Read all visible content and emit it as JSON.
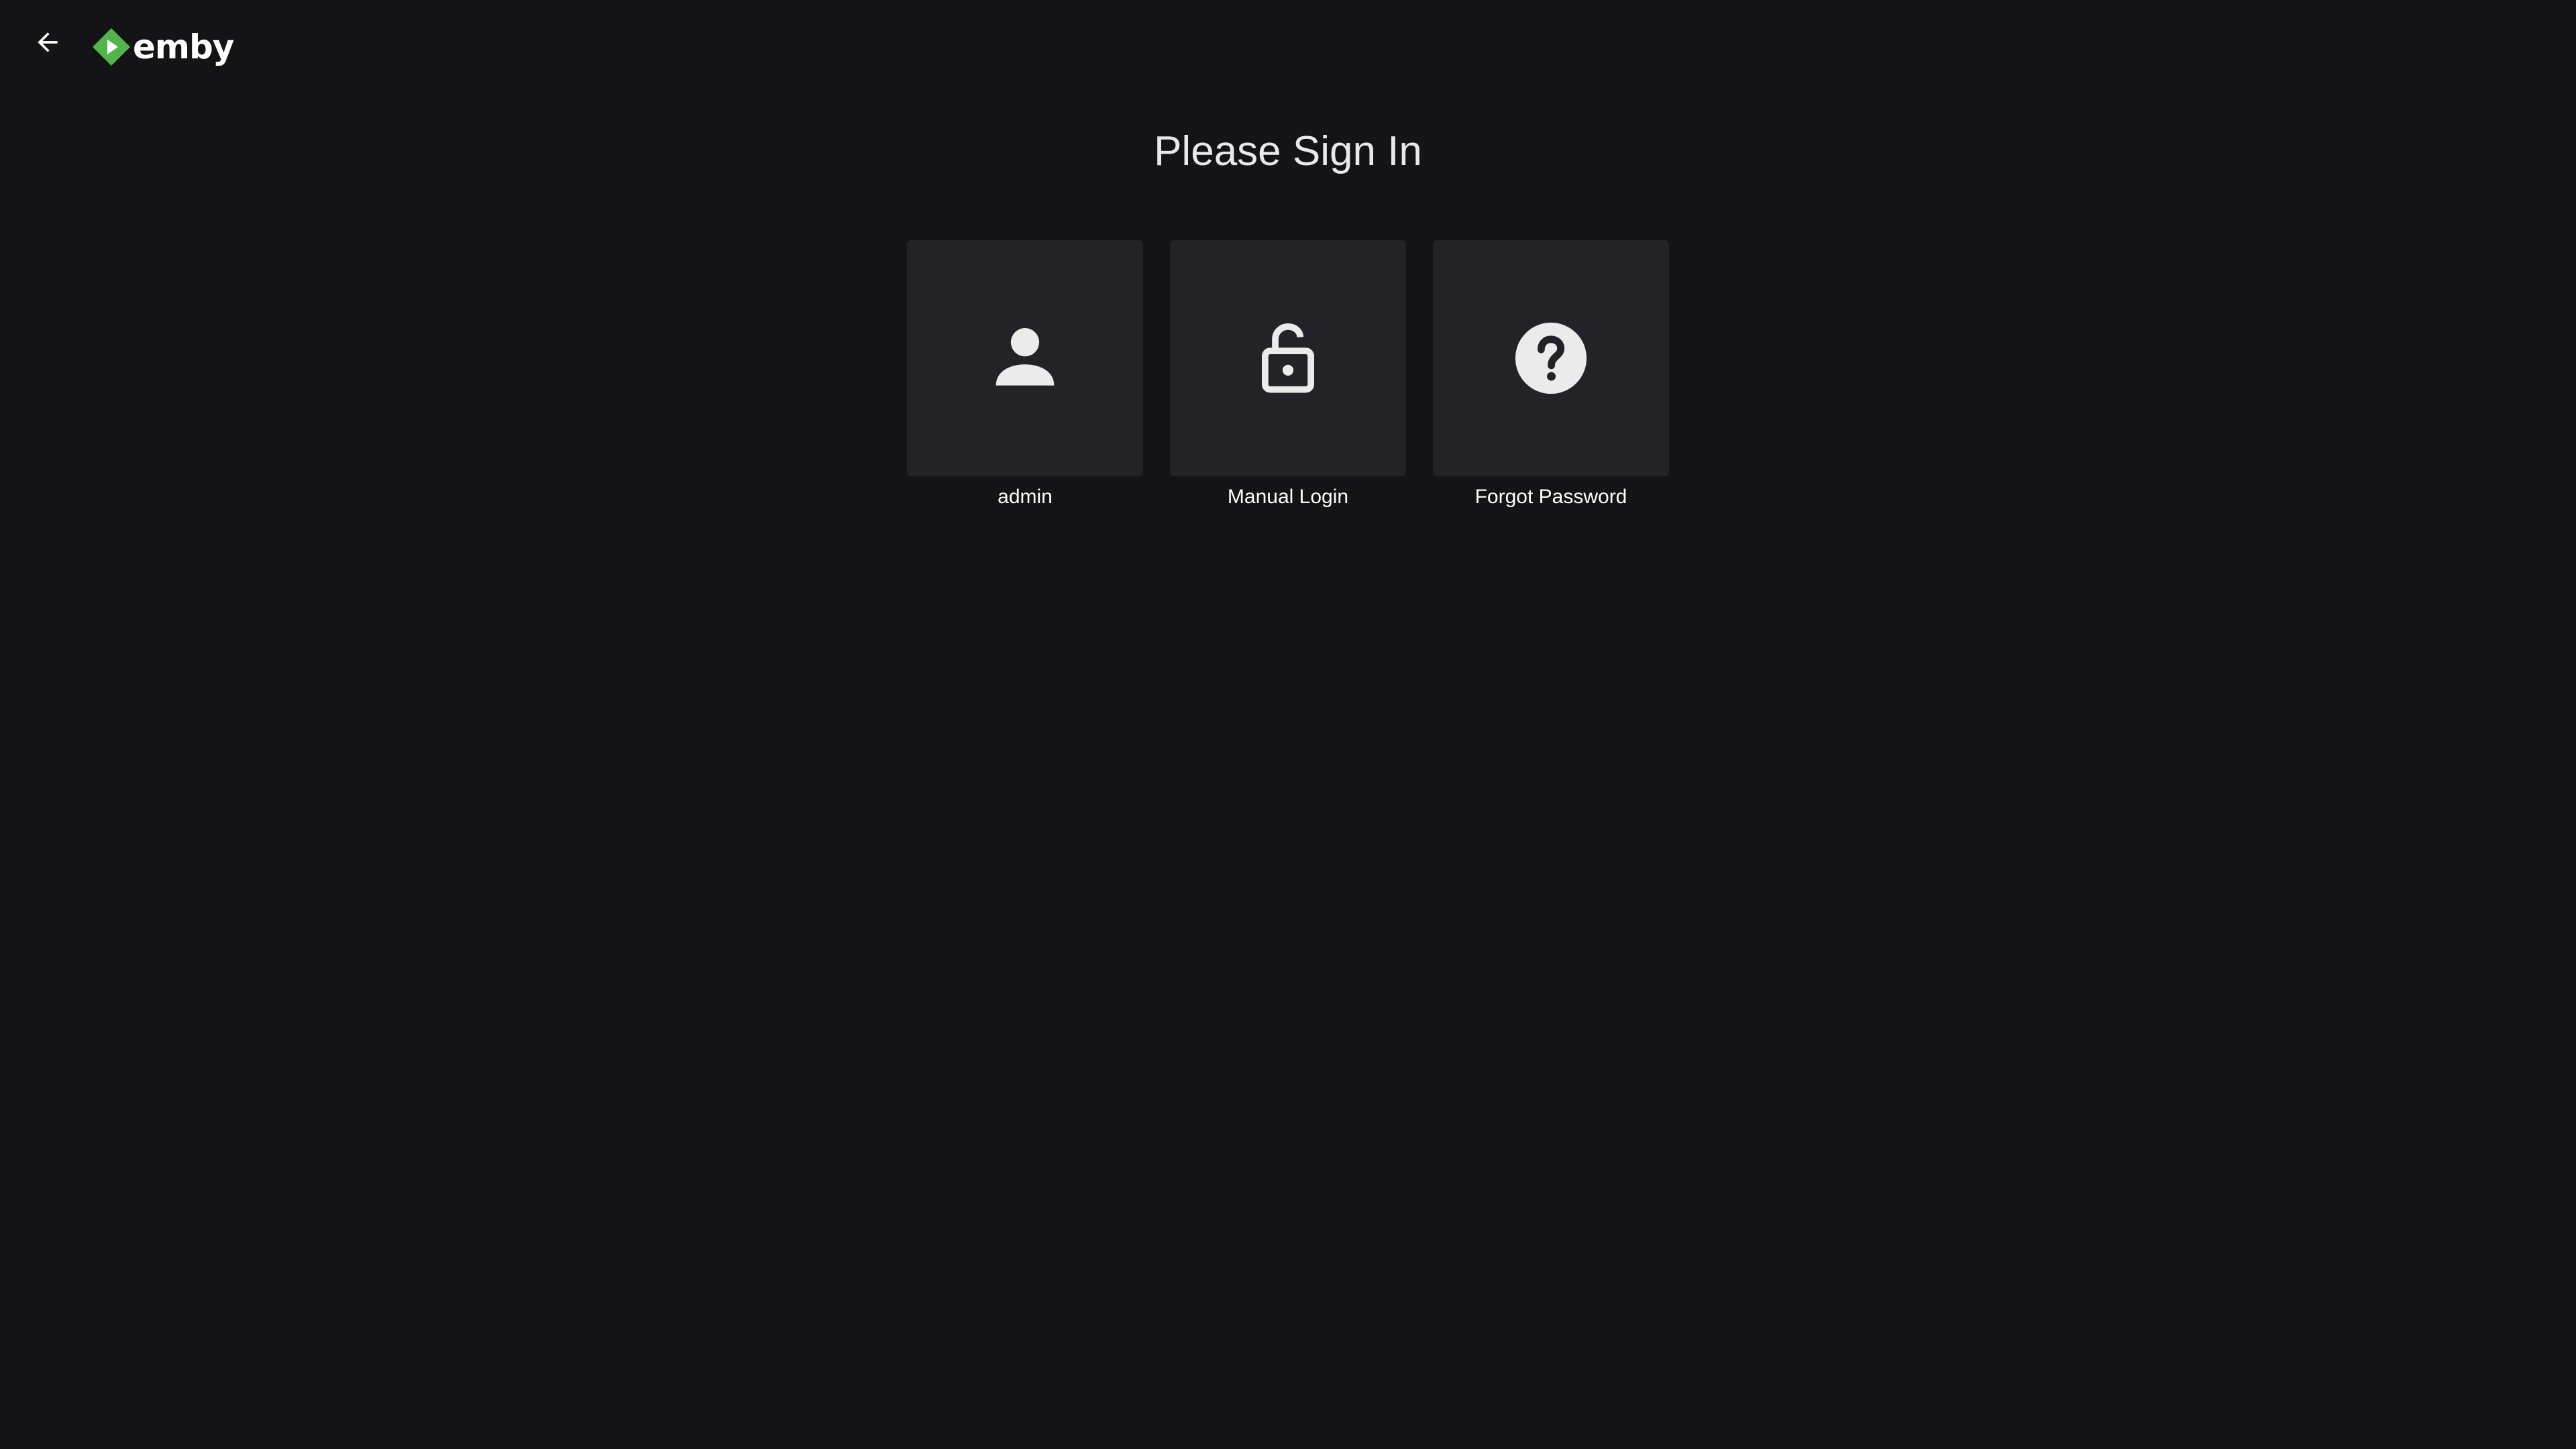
{
  "app": {
    "brand": "emby",
    "accent_color": "#52b54b"
  },
  "header": {
    "back_icon": "arrow-left-icon",
    "logo_icon": "emby-logo-icon"
  },
  "main": {
    "title": "Please Sign In",
    "cards": [
      {
        "label": "admin",
        "icon": "person-icon"
      },
      {
        "label": "Manual Login",
        "icon": "lock-open-icon"
      },
      {
        "label": "Forgot Password",
        "icon": "help-circle-icon"
      }
    ]
  }
}
